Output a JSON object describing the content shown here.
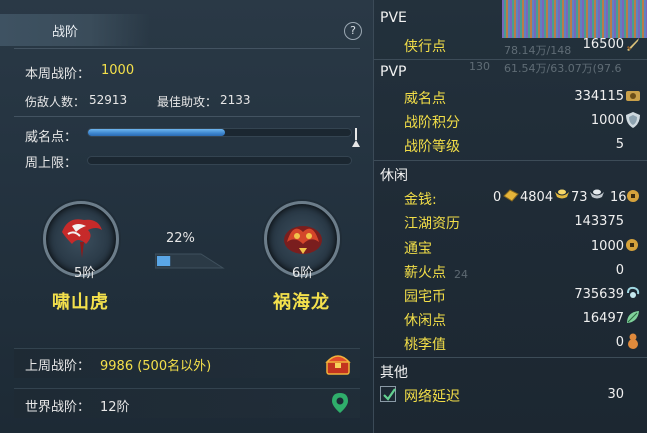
{
  "left": {
    "tab_title": "战阶",
    "help_label": "?",
    "weekly_rank_label": "本周战阶：",
    "weekly_rank_value": "1000",
    "injured_label": "伤敌人数：",
    "injured_value": "52913",
    "best_assist_label": "最佳助攻：",
    "best_assist_value": "2133",
    "prestige_label": "威名点：",
    "prestige_progress": 0.52,
    "weekly_cap_label": "周上限：",
    "weekly_cap_progress": 0,
    "current_rank": {
      "level": "5阶",
      "name": "啸山虎"
    },
    "next_rank": {
      "level": "6阶",
      "name": "祸海龙"
    },
    "progress_percent": "22%",
    "last_week_label": "上周战阶：",
    "last_week_value": "9986 (500名以外)",
    "world_rank_label": "世界战阶：",
    "world_rank_value": "12阶"
  },
  "right": {
    "pve_title": "PVE",
    "pve_items": [
      {
        "label": "侠行点",
        "value": "16500",
        "icon": "sword-icon"
      }
    ],
    "pvp_title": "PVP",
    "pvp_items": [
      {
        "label": "威名点",
        "value": "334115",
        "icon": "prestige-icon"
      },
      {
        "label": "战阶积分",
        "value": "1000",
        "icon": "shield-icon"
      },
      {
        "label": "战阶等级",
        "value": "5"
      }
    ],
    "leisure_title": "休闲",
    "money_label": "金钱:",
    "money_values": [
      "0",
      "4804",
      "73",
      "16"
    ],
    "leisure_items": [
      {
        "label": "江湖资历",
        "value": "143375"
      },
      {
        "label": "通宝",
        "value": "1000",
        "icon": "coin-icon"
      },
      {
        "label": "薪火点",
        "value": "0"
      },
      {
        "label": "园宅币",
        "value": "735639",
        "icon": "house-coin-icon"
      },
      {
        "label": "休闲点",
        "value": "16497",
        "icon": "leaf-icon"
      },
      {
        "label": "桃李值",
        "value": "0",
        "icon": "gourd-icon"
      }
    ],
    "other_title": "其他",
    "network_label": "网络延迟",
    "network_value": "30",
    "network_checked": true,
    "faded_text_1": "78.14万/148",
    "faded_text_2": "130",
    "faded_text_3": "61.54万/63.07万(97.6",
    "faded_text_4": "24"
  }
}
